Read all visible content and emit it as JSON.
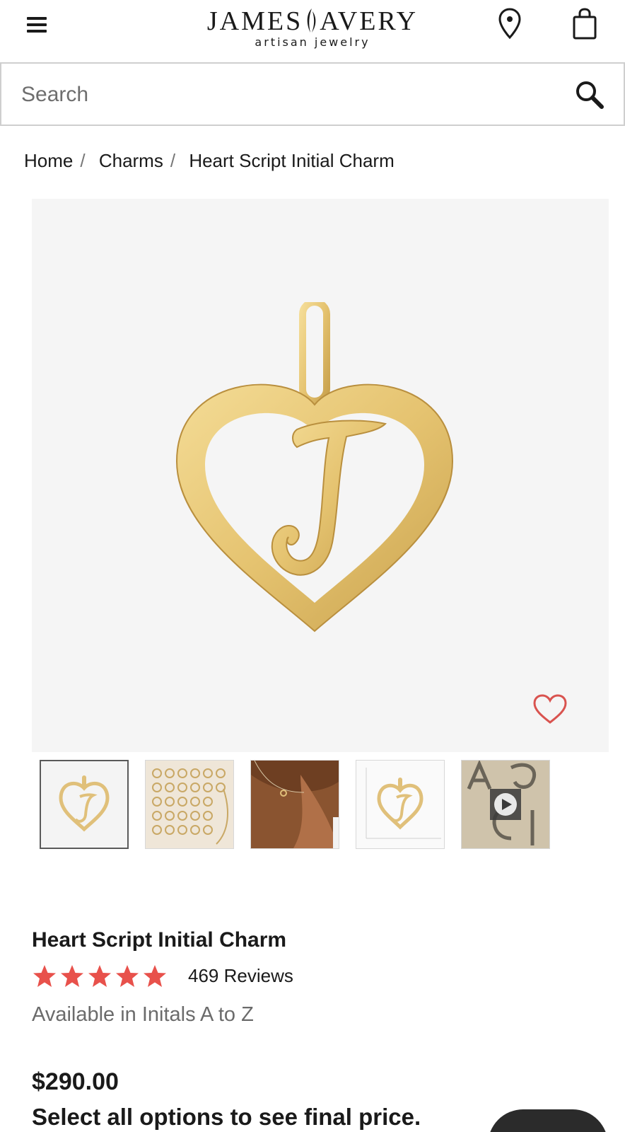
{
  "header": {
    "logo_main_left": "JAMES",
    "logo_main_right": "AVERY",
    "logo_sub": "artisan jewelry",
    "icons": {
      "menu": "hamburger-menu-icon",
      "store": "map-pin-icon",
      "bag": "shopping-bag-icon"
    }
  },
  "search": {
    "placeholder": "Search",
    "value": "",
    "icon": "magnifier-icon"
  },
  "breadcrumb": [
    {
      "label": "Home"
    },
    {
      "label": "Charms"
    },
    {
      "label": "Heart Script Initial Charm"
    }
  ],
  "breadcrumb_separator": "/",
  "gallery": {
    "main_image": "gold heart charm with script letter J",
    "wishlist_icon": "heart-outline-icon",
    "thumbnails": [
      {
        "alt": "heart charm J",
        "selected": true
      },
      {
        "alt": "all initials A to Z grid",
        "selected": false
      },
      {
        "alt": "charm worn on necklace",
        "selected": false
      },
      {
        "alt": "charm size reference",
        "selected": false
      },
      {
        "alt": "video of charms",
        "selected": false,
        "icon": "play-icon"
      }
    ]
  },
  "product": {
    "title": "Heart Script Initial Charm",
    "rating": 5,
    "rating_max": 5,
    "reviews_label": "469 Reviews",
    "availability": "Available in Initals A to Z",
    "price": "$290.00",
    "price_note": "Select all options to see final price."
  },
  "colors": {
    "star": "#e8514b",
    "wishlist_heart": "#d9534f",
    "gold": "#e6c77a",
    "image_bg": "#f5f5f5"
  }
}
